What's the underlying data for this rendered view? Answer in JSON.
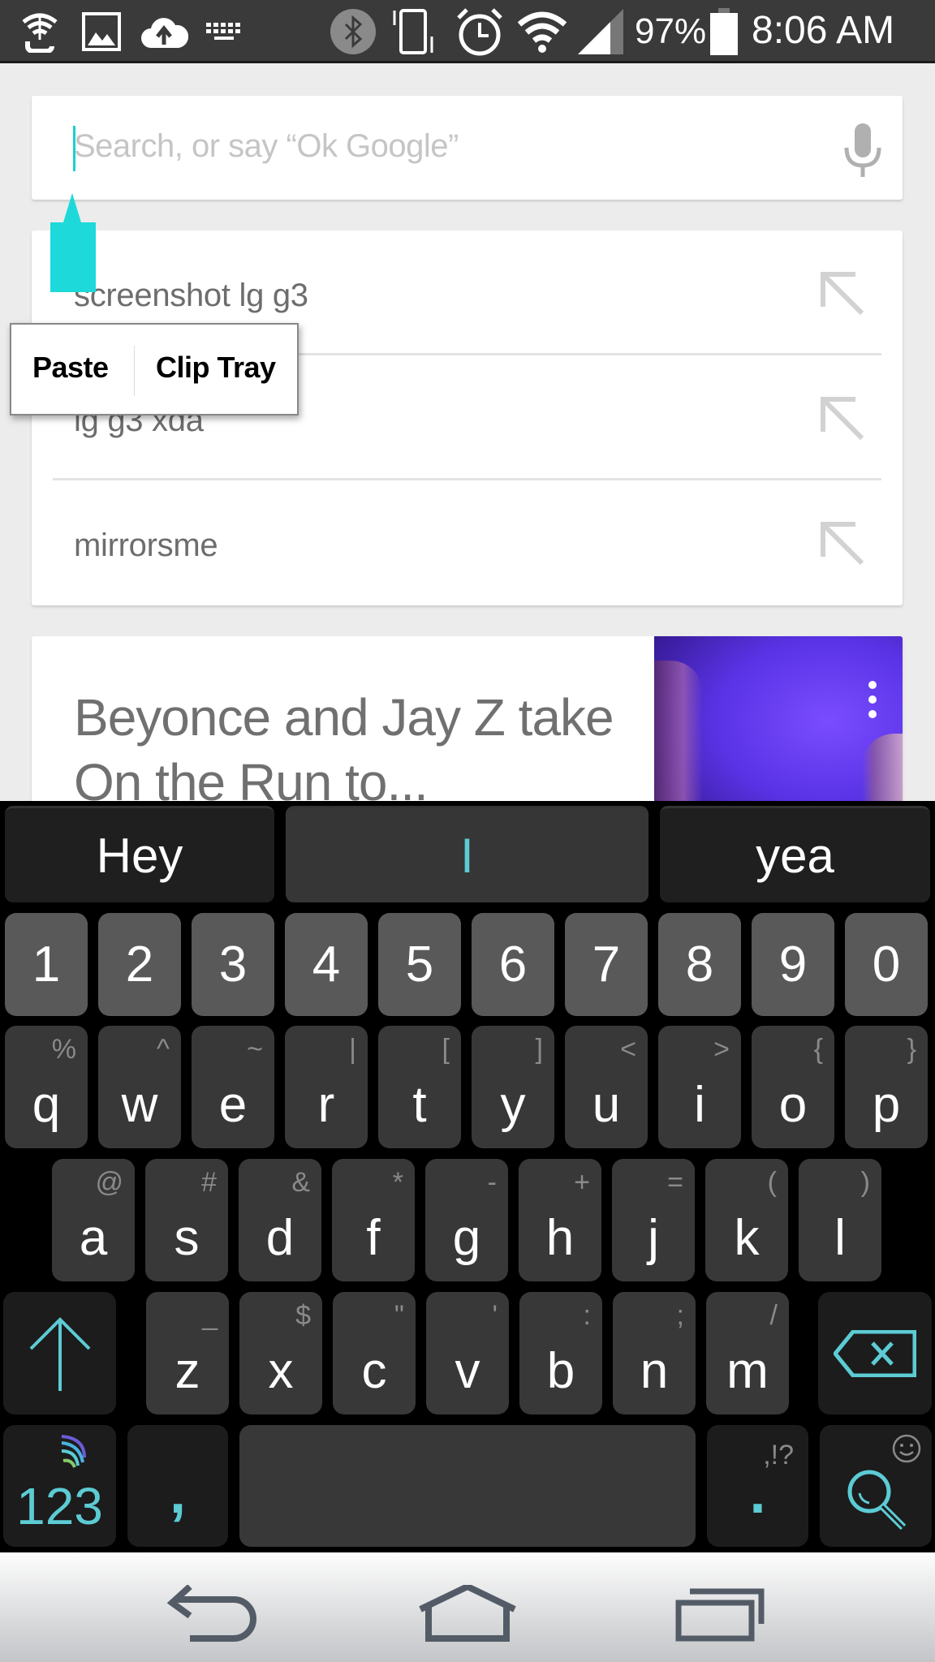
{
  "status_bar": {
    "left_icons": [
      "wifi-hotspot-icon",
      "gallery-icon",
      "cloud-upload-icon",
      "keyboard-icon"
    ],
    "right_icons": [
      "bluetooth-icon",
      "vibrate-icon",
      "alarm-icon",
      "wifi-icon",
      "signal-icon",
      "battery-icon"
    ],
    "battery": "97%",
    "time": "8:06 AM"
  },
  "search": {
    "placeholder": "Search, or say “Ok Google”",
    "value": "",
    "mic_icon": "microphone-icon"
  },
  "suggestions": [
    {
      "text": "screenshot lg g3",
      "icon": "arrow-up-left-icon"
    },
    {
      "text": "lg g3 xda",
      "icon": "arrow-up-left-icon"
    },
    {
      "text": "mirrorsme",
      "icon": "arrow-up-left-icon"
    }
  ],
  "context_menu": {
    "items": [
      "Paste",
      "Clip Tray"
    ]
  },
  "news_card": {
    "headline": "Beyonce and Jay Z take On the Run to...",
    "menu_icon": "more-vert-icon"
  },
  "keyboard": {
    "predictions": [
      "Hey",
      "I",
      "yea"
    ],
    "number_row": [
      "1",
      "2",
      "3",
      "4",
      "5",
      "6",
      "7",
      "8",
      "9",
      "0"
    ],
    "row1": [
      {
        "k": "q",
        "s": "%"
      },
      {
        "k": "w",
        "s": "^"
      },
      {
        "k": "e",
        "s": "~"
      },
      {
        "k": "r",
        "s": "|"
      },
      {
        "k": "t",
        "s": "["
      },
      {
        "k": "y",
        "s": "]"
      },
      {
        "k": "u",
        "s": "<"
      },
      {
        "k": "i",
        "s": ">"
      },
      {
        "k": "o",
        "s": "{"
      },
      {
        "k": "p",
        "s": "}"
      }
    ],
    "row2": [
      {
        "k": "a",
        "s": "@"
      },
      {
        "k": "s",
        "s": "#"
      },
      {
        "k": "d",
        "s": "&"
      },
      {
        "k": "f",
        "s": "*"
      },
      {
        "k": "g",
        "s": "-"
      },
      {
        "k": "h",
        "s": "+"
      },
      {
        "k": "j",
        "s": "="
      },
      {
        "k": "k",
        "s": "("
      },
      {
        "k": "l",
        "s": ")"
      }
    ],
    "row3": [
      {
        "k": "z",
        "s": "_"
      },
      {
        "k": "x",
        "s": "$"
      },
      {
        "k": "c",
        "s": "\""
      },
      {
        "k": "v",
        "s": "'"
      },
      {
        "k": "b",
        "s": ":"
      },
      {
        "k": "n",
        "s": ";"
      },
      {
        "k": "m",
        "s": "/"
      }
    ],
    "symbols_key": "123",
    "comma_key": ",",
    "period_key": ".",
    "period_alt": ",!?",
    "accent_color": "#5ccbd4"
  },
  "nav_bar": {
    "buttons": [
      "back",
      "home",
      "recent-apps"
    ]
  }
}
